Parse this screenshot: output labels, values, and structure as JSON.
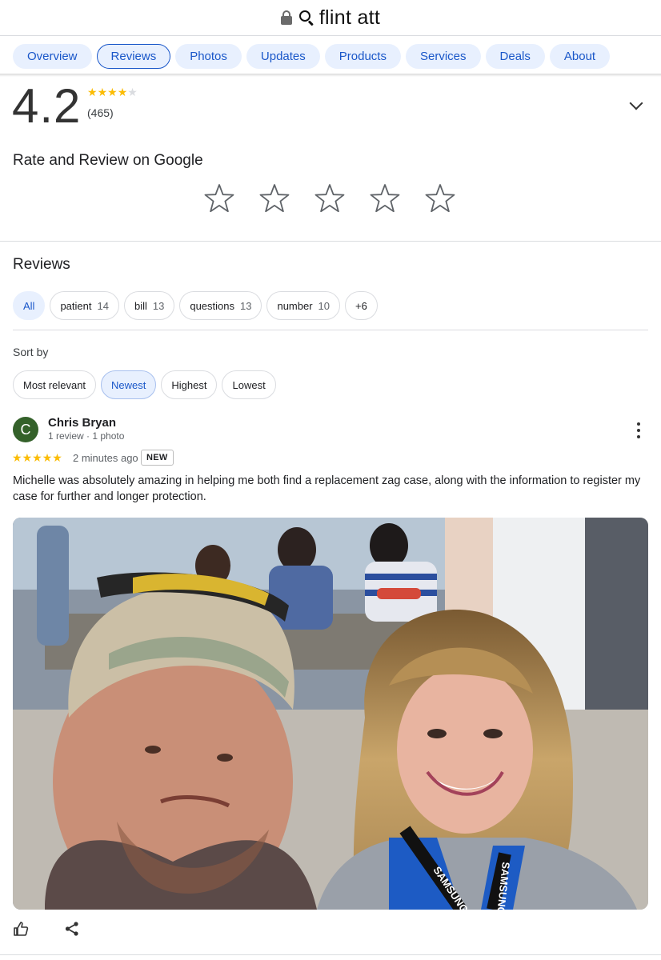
{
  "urlbar": {
    "query": "flint att",
    "lock_icon": "lock-icon",
    "search_icon": "search-icon"
  },
  "tabs": [
    {
      "label": "Overview",
      "active": false
    },
    {
      "label": "Reviews",
      "active": true
    },
    {
      "label": "Photos",
      "active": false
    },
    {
      "label": "Updates",
      "active": false
    },
    {
      "label": "Products",
      "active": false
    },
    {
      "label": "Services",
      "active": false
    },
    {
      "label": "Deals",
      "active": false
    },
    {
      "label": "About",
      "active": false
    }
  ],
  "summary": {
    "rating": "4.2",
    "stars_filled": 4,
    "count": "(465)"
  },
  "rate": {
    "title": "Rate and Review on Google",
    "star_count": 5
  },
  "reviews": {
    "title": "Reviews",
    "topics": [
      {
        "label": "All",
        "count": "",
        "selected": true
      },
      {
        "label": "patient",
        "count": "14",
        "selected": false
      },
      {
        "label": "bill",
        "count": "13",
        "selected": false
      },
      {
        "label": "questions",
        "count": "13",
        "selected": false
      },
      {
        "label": "number",
        "count": "10",
        "selected": false
      },
      {
        "label": "+6",
        "count": "",
        "selected": false
      }
    ],
    "sort_label": "Sort by",
    "sorts": [
      {
        "label": "Most relevant",
        "selected": false
      },
      {
        "label": "Newest",
        "selected": true
      },
      {
        "label": "Highest",
        "selected": false
      },
      {
        "label": "Lowest",
        "selected": false
      }
    ]
  },
  "review": {
    "avatar_letter": "C",
    "name": "Chris Bryan",
    "meta": "1 review · 1 photo",
    "stars": 5,
    "time": "2 minutes ago",
    "badge": "NEW",
    "text": "Michelle was absolutely amazing in helping me both find a replacement zag case, along with the information to register my case for further and longer protection.",
    "photo_lanyard_text": "SAMSUNG"
  },
  "colors": {
    "accent": "#1a57c9",
    "chip_bg": "#e8f0fe",
    "star": "#fbbc04",
    "avatar": "#34612a"
  }
}
